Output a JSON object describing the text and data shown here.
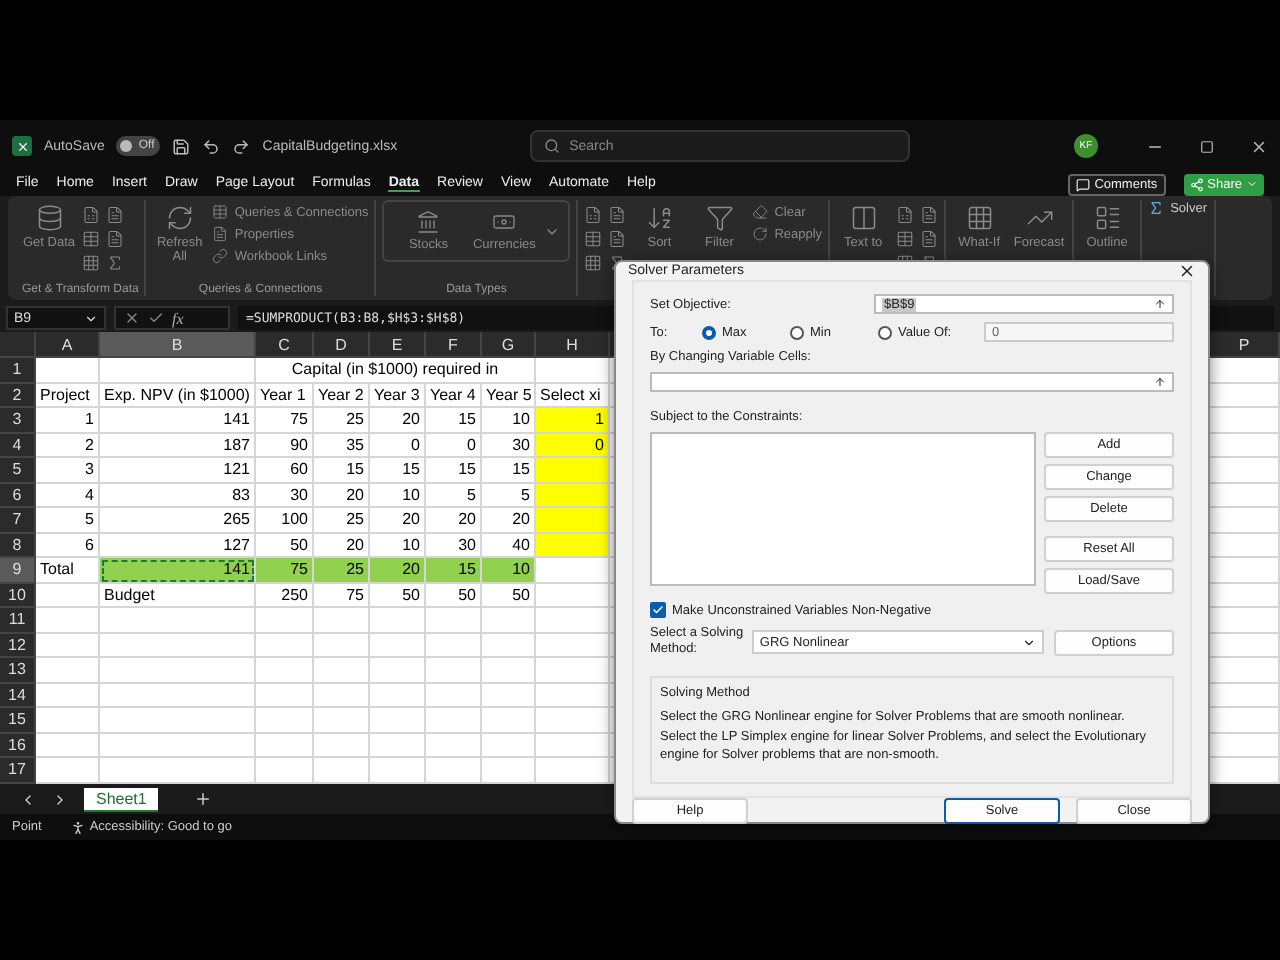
{
  "title_bar": {
    "autosave_label": "AutoSave",
    "autosave_state": "Off",
    "autosave_on": false,
    "file_name": "CapitalBudgeting.xlsx",
    "search": {
      "placeholder": "Search"
    },
    "user_initials": "KF"
  },
  "menu_tabs": [
    {
      "label": "File",
      "selected": false
    },
    {
      "label": "Home",
      "selected": false
    },
    {
      "label": "Insert",
      "selected": false
    },
    {
      "label": "Draw",
      "selected": false
    },
    {
      "label": "Page Layout",
      "selected": false
    },
    {
      "label": "Formulas",
      "selected": false
    },
    {
      "label": "Data",
      "selected": true
    },
    {
      "label": "Review",
      "selected": false
    },
    {
      "label": "View",
      "selected": false
    },
    {
      "label": "Automate",
      "selected": false
    },
    {
      "label": "Help",
      "selected": false
    }
  ],
  "menu_buttons": [
    {
      "kind": "comments",
      "label": "Comments"
    },
    {
      "kind": "share",
      "label": "Share"
    }
  ],
  "ribbon": [
    {
      "label": "Get & Transform Data",
      "commands": [
        {
          "kind": "large",
          "label": "Get Data"
        },
        {
          "kind": "icon_grid"
        }
      ]
    },
    {
      "label": "Queries & Connections",
      "commands": [
        {
          "kind": "large",
          "label": "Refresh All"
        },
        {
          "kind": "small",
          "label": "Queries & Connections"
        },
        {
          "kind": "small",
          "label": "Properties"
        },
        {
          "kind": "small",
          "label": "Workbook Links"
        }
      ]
    },
    {
      "label": "Data Types",
      "commands": [
        {
          "kind": "boxed",
          "label": "Stocks"
        },
        {
          "kind": "boxed",
          "label": "Currencies"
        }
      ]
    },
    {
      "commands": [
        {
          "kind": "icon_grid"
        },
        {
          "kind": "large",
          "label": "Sort"
        },
        {
          "kind": "large",
          "label": "Filter"
        },
        {
          "kind": "small",
          "label": "Clear"
        },
        {
          "kind": "small",
          "label": "Reapply"
        }
      ]
    },
    {
      "commands": [
        {
          "kind": "large",
          "label": "Text to"
        },
        {
          "kind": "icon_grid"
        }
      ]
    },
    {
      "commands": [
        {
          "kind": "large",
          "label": "What-If"
        },
        {
          "kind": "large",
          "label": "Forecast"
        }
      ]
    },
    {
      "commands": [
        {
          "kind": "large",
          "label": "Outline"
        }
      ]
    },
    {
      "commands": [
        {
          "kind": "solver",
          "label": "Solver"
        }
      ]
    }
  ],
  "formula_bar": {
    "name_box": "B9",
    "function_label": "fx",
    "formula": "=SUMPRODUCT(B3:B8,$H$3:$H$8)"
  },
  "sheet": {
    "column_headers": [
      "A",
      "B",
      "C",
      "D",
      "E",
      "F",
      "G",
      "H",
      "P"
    ],
    "rows": [
      {
        "number": "1",
        "cells": [
          {
            "kind": "empty",
            "selected": false
          },
          {
            "kind": "empty",
            "selected": false
          },
          {
            "kind": "merged",
            "text": "Capital (in $1000) required in",
            "selected": false
          },
          {
            "kind": "empty",
            "selected": false
          }
        ]
      },
      {
        "number": "2",
        "cells": [
          {
            "kind": "text",
            "text": "Project",
            "selected": false
          },
          {
            "kind": "text",
            "text": "Exp. NPV (in $1000)",
            "selected": false
          },
          {
            "kind": "text",
            "text": "Year 1",
            "selected": false
          },
          {
            "kind": "text",
            "text": "Year 2",
            "selected": false
          },
          {
            "kind": "text",
            "text": "Year 3",
            "selected": false
          },
          {
            "kind": "text",
            "text": "Year 4",
            "selected": false
          },
          {
            "kind": "text",
            "text": "Year 5",
            "selected": false
          },
          {
            "kind": "text",
            "text": "Select xi",
            "selected": false
          }
        ]
      },
      {
        "number": "3",
        "cells": [
          {
            "kind": "number",
            "text": "1",
            "selected": false
          },
          {
            "kind": "number",
            "text": "141",
            "selected": false
          },
          {
            "kind": "number",
            "text": "75",
            "selected": false
          },
          {
            "kind": "number",
            "text": "25",
            "selected": false
          },
          {
            "kind": "number",
            "text": "20",
            "selected": false
          },
          {
            "kind": "number",
            "text": "15",
            "selected": false
          },
          {
            "kind": "number",
            "text": "10",
            "selected": false
          },
          {
            "kind": "number",
            "text": "1",
            "color": "#ffff00",
            "selected": false
          }
        ]
      },
      {
        "number": "4",
        "cells": [
          {
            "kind": "number",
            "text": "2",
            "selected": false
          },
          {
            "kind": "number",
            "text": "187",
            "selected": false
          },
          {
            "kind": "number",
            "text": "90",
            "selected": false
          },
          {
            "kind": "number",
            "text": "35",
            "selected": false
          },
          {
            "kind": "number",
            "text": "0",
            "selected": false
          },
          {
            "kind": "number",
            "text": "0",
            "selected": false
          },
          {
            "kind": "number",
            "text": "30",
            "selected": false
          },
          {
            "kind": "number",
            "text": "0",
            "color": "#ffff00",
            "selected": false
          }
        ]
      },
      {
        "number": "5",
        "cells": [
          {
            "kind": "number",
            "text": "3",
            "selected": false
          },
          {
            "kind": "number",
            "text": "121",
            "selected": false
          },
          {
            "kind": "number",
            "text": "60",
            "selected": false
          },
          {
            "kind": "number",
            "text": "15",
            "selected": false
          },
          {
            "kind": "number",
            "text": "15",
            "selected": false
          },
          {
            "kind": "number",
            "text": "15",
            "selected": false
          },
          {
            "kind": "number",
            "text": "15",
            "selected": false
          },
          {
            "kind": "empty",
            "color": "#ffff00",
            "selected": false
          }
        ]
      },
      {
        "number": "6",
        "cells": [
          {
            "kind": "number",
            "text": "4",
            "selected": false
          },
          {
            "kind": "number",
            "text": "83",
            "selected": false
          },
          {
            "kind": "number",
            "text": "30",
            "selected": false
          },
          {
            "kind": "number",
            "text": "20",
            "selected": false
          },
          {
            "kind": "number",
            "text": "10",
            "selected": false
          },
          {
            "kind": "number",
            "text": "5",
            "selected": false
          },
          {
            "kind": "number",
            "text": "5",
            "selected": false
          },
          {
            "kind": "empty",
            "color": "#ffff00",
            "selected": false
          }
        ]
      },
      {
        "number": "7",
        "cells": [
          {
            "kind": "number",
            "text": "5",
            "selected": false
          },
          {
            "kind": "number",
            "text": "265",
            "selected": false
          },
          {
            "kind": "number",
            "text": "100",
            "selected": false
          },
          {
            "kind": "number",
            "text": "25",
            "selected": false
          },
          {
            "kind": "number",
            "text": "20",
            "selected": false
          },
          {
            "kind": "number",
            "text": "20",
            "selected": false
          },
          {
            "kind": "number",
            "text": "20",
            "selected": false
          },
          {
            "kind": "empty",
            "color": "#ffff00",
            "selected": false
          }
        ]
      },
      {
        "number": "8",
        "cells": [
          {
            "kind": "number",
            "text": "6",
            "selected": false
          },
          {
            "kind": "number",
            "text": "127",
            "selected": false
          },
          {
            "kind": "number",
            "text": "50",
            "selected": false
          },
          {
            "kind": "number",
            "text": "20",
            "selected": false
          },
          {
            "kind": "number",
            "text": "10",
            "selected": false
          },
          {
            "kind": "number",
            "text": "30",
            "selected": false
          },
          {
            "kind": "number",
            "text": "40",
            "selected": false
          },
          {
            "kind": "empty",
            "color": "#ffff00",
            "selected": false
          }
        ]
      },
      {
        "number": "9",
        "cells": [
          {
            "kind": "text",
            "text": "Total",
            "selected": false
          },
          {
            "kind": "number",
            "text": "141",
            "color": "#92d050",
            "selected": true
          },
          {
            "kind": "number",
            "text": "75",
            "color": "#92d050",
            "selected": false
          },
          {
            "kind": "number",
            "text": "25",
            "color": "#92d050",
            "selected": false
          },
          {
            "kind": "number",
            "text": "20",
            "color": "#92d050",
            "selected": false
          },
          {
            "kind": "number",
            "text": "15",
            "color": "#92d050",
            "selected": false
          },
          {
            "kind": "number",
            "text": "10",
            "color": "#92d050",
            "selected": false
          },
          {
            "kind": "empty",
            "selected": false
          }
        ]
      },
      {
        "number": "10",
        "cells": [
          {
            "kind": "empty",
            "selected": false
          },
          {
            "kind": "text",
            "text": "Budget",
            "selected": false
          },
          {
            "kind": "number",
            "text": "250",
            "selected": false
          },
          {
            "kind": "number",
            "text": "75",
            "selected": false
          },
          {
            "kind": "number",
            "text": "50",
            "selected": false
          },
          {
            "kind": "number",
            "text": "50",
            "selected": false
          },
          {
            "kind": "number",
            "text": "50",
            "selected": false
          },
          {
            "kind": "empty",
            "selected": false
          }
        ]
      },
      {
        "number": "11"
      },
      {
        "number": "12"
      },
      {
        "number": "13"
      },
      {
        "number": "14"
      },
      {
        "number": "15"
      },
      {
        "number": "16"
      },
      {
        "number": "17"
      }
    ]
  },
  "sheet_tabs": [
    {
      "label": "Sheet1",
      "selected": true
    }
  ],
  "status_bar": {
    "mode": "Point",
    "accessibility": "Accessibility: Good to go"
  },
  "dialog": {
    "title": "Solver Parameters",
    "objective": {
      "label": "Set Objective:",
      "value": "$B$9"
    },
    "to": {
      "label": "To:",
      "options": [
        {
          "label": "Max",
          "selected": true
        },
        {
          "label": "Min",
          "selected": false
        },
        {
          "label": "Value Of:",
          "selected": false
        }
      ],
      "value": "0"
    },
    "changing_cells": {
      "label": "By Changing Variable Cells:"
    },
    "constraints": {
      "label": "Subject to the Constraints:",
      "buttons": [
        "Add",
        "Change",
        "Delete",
        "Reset All",
        "Load/Save"
      ]
    },
    "nonnegative": {
      "label": "Make Unconstrained Variables Non-Negative",
      "checked": true
    },
    "method": {
      "label": "Select a Solving Method:",
      "value": "GRG Nonlinear",
      "button": "Options"
    },
    "method_info": {
      "title": "Solving Method",
      "text": "Select the GRG Nonlinear engine for Solver Problems that are smooth nonlinear. Select the LP Simplex engine for linear Solver Problems, and select the Evolutionary engine for Solver problems that are non-smooth."
    },
    "footer_buttons": [
      {
        "label": "Help",
        "default": false
      },
      {
        "label": "Solve",
        "default": true
      },
      {
        "label": "Close",
        "default": false
      }
    ]
  }
}
